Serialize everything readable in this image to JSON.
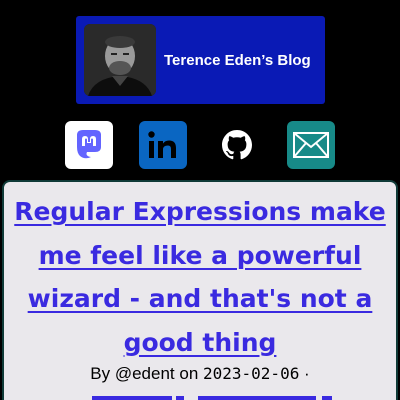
{
  "site": {
    "title": "Terence Eden’s Blog",
    "header_bg": "#0a1ab5"
  },
  "social": [
    {
      "name": "mastodon",
      "icon": "mastodon-icon",
      "bg": "#ffffff",
      "fg": "#6364ff"
    },
    {
      "name": "linkedin",
      "icon": "linkedin-icon",
      "bg": "#0a66c2",
      "fg": "#000000"
    },
    {
      "name": "github",
      "icon": "github-icon",
      "bg": "#000000",
      "fg": "#ffffff"
    },
    {
      "name": "email",
      "icon": "email-icon",
      "bg": "#178a88",
      "fg": "#ffffff"
    }
  ],
  "post": {
    "title": "Regular Expressions make me feel like a powerful wizard - and that's not a good thing",
    "byline_prefix": "By ",
    "author": "@edent",
    "byline_on": " on ",
    "date": "2023-02-06",
    "separator": " ·",
    "link_color": "#3a2ae0"
  }
}
